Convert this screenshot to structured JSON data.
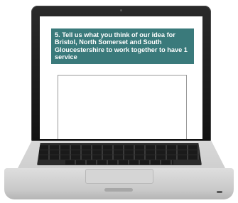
{
  "screen": {
    "question_text": "5. Tell us what you think of our idea for Bristol, North Somerset and South Gloucestershire to work together to have 1 service",
    "answer_value": ""
  },
  "colors": {
    "question_background": "#3a7a7b",
    "question_text": "#ffffff",
    "laptop_bezel": "#1e1e1e",
    "laptop_body": "#d6d6d6"
  },
  "icons": {
    "device": "laptop"
  }
}
